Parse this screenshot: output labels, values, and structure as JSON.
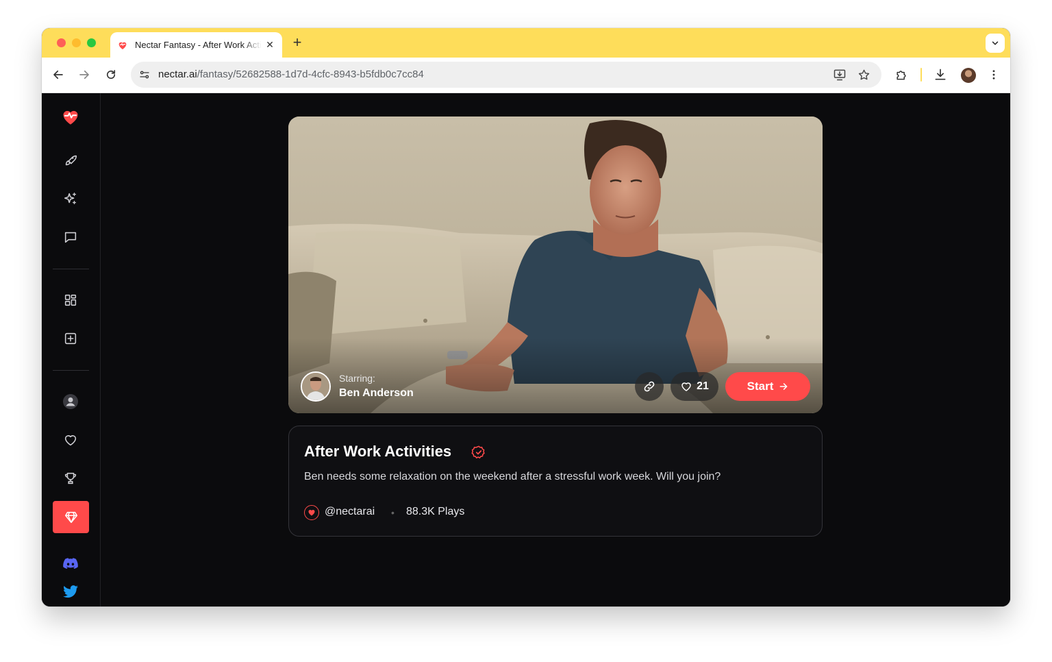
{
  "browser": {
    "tab_title": "Nectar Fantasy - After Work Activities",
    "new_tab_label": "+",
    "url_host": "nectar.ai",
    "url_path": "/fantasy/52682588-1d7d-4cfc-8943-b5fdb0c7cc84",
    "accent_color": "#fedd5a"
  },
  "sidebar": {
    "items": [
      {
        "name": "logo",
        "icon": "heart-pulse-icon"
      },
      {
        "name": "explore",
        "icon": "rocket-icon"
      },
      {
        "name": "create",
        "icon": "sparkles-icon"
      },
      {
        "name": "chat",
        "icon": "chat-bubble-icon"
      },
      {
        "name": "gallery",
        "icon": "grid-icon"
      },
      {
        "name": "new",
        "icon": "plus-square-icon"
      },
      {
        "name": "profile",
        "icon": "user-icon"
      },
      {
        "name": "favorites",
        "icon": "heart-icon"
      },
      {
        "name": "leaderboard",
        "icon": "trophy-icon"
      },
      {
        "name": "premium",
        "icon": "gem-icon",
        "active": true
      },
      {
        "name": "discord",
        "icon": "discord-icon"
      },
      {
        "name": "twitter",
        "icon": "twitter-icon"
      }
    ],
    "active_color": "#ff4a4a"
  },
  "hero": {
    "starring_label": "Starring:",
    "starring_name": "Ben Anderson",
    "like_count": "21",
    "start_label": "Start"
  },
  "card": {
    "title": "After Work Activities",
    "description": "Ben needs some relaxation on the weekend after a stressful work week. Will you join?",
    "creator": "@nectarai",
    "separator": "•",
    "plays": "88.3K Plays"
  }
}
